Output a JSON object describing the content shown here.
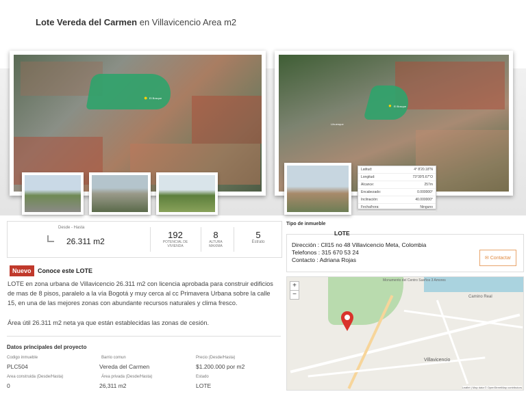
{
  "header": {
    "title_bold": "Lote Vereda del Carmen",
    "title_rest": " en Villavicencio Area m2"
  },
  "gallery": {
    "main_photo_label": "El Bosque",
    "second_photo_label": "El Bosque",
    "second_photo_label2": "Lihuenque",
    "coords_panel": [
      {
        "label": "Latitud:",
        "value": "4° 8'20.18\"N"
      },
      {
        "label": "Longitud:",
        "value": "73°39'5.67\"O"
      },
      {
        "label": "Alcance:",
        "value": "257m"
      },
      {
        "label": "Encabezado:",
        "value": "0.000000°"
      },
      {
        "label": "Inclinación:",
        "value": "40.000000°"
      },
      {
        "label": "Fecha/hora:",
        "value": "Ninguno"
      }
    ]
  },
  "stats": {
    "range_label": "Desde - Hasta",
    "area": "26.311 m2",
    "potencial_value": "192",
    "potencial_label1": "POTENCIAL DE",
    "potencial_label2": "VIVIENDA",
    "altura_value": "8",
    "altura_label1": "ALTURA",
    "altura_label2": "MAXIMA",
    "estrato_value": "5",
    "estrato_label": "Estrato"
  },
  "description": {
    "badge": "Nuevo",
    "heading": "Conoce este LOTE",
    "text": "LOTE en zona urbana de Villavicencio 26.311 m2 con licencia aprobada para construir edificios de mas de 8 pisos, paralelo a la vía Bogotá y muy cerca al cc Primavera Urbana sobre la calle 15, en una de las mejores zonas con abundante recursos naturales y clima fresco.",
    "text2": "Área útil 26.311 m2 neta ya que están establecidas las zonas de cesión."
  },
  "project": {
    "heading": "Datos principales del proyecto",
    "codigo_label": "Codigo inmueble",
    "codigo_value": "PLC504",
    "barrio_label": "Barrio comun",
    "barrio_value": "Vereda del Carmen",
    "precio_label": "Precio (Desde/Hasta)",
    "precio_value": "$1.200.000 por m2",
    "area_const_label": "Area construida (Desde/Hasta)",
    "area_const_value": "0",
    "area_priv_label": "Área privada (Desde/Hasta)",
    "area_priv_value": "26,311 m2",
    "estado_label": "Estado",
    "estado_value": "LOTE"
  },
  "contact": {
    "tipo_label": "Tipo de inmueble",
    "tipo_value": "LOTE",
    "direccion": "Dirección : Cll15 no 48 Villavicencio Meta, Colombia",
    "telefonos": "Telefonos : 315 670 53 24",
    "contacto": "Contacto : Adriana Rojas",
    "button": "Contactar"
  },
  "map": {
    "zoom_in": "+",
    "zoom_out": "−",
    "label_city": "Villavicencio",
    "label_road": "Camino Real",
    "label_top": "Monumento del Centro Sueños 3 Amores",
    "attribution": "Leaflet | Map data © OpenStreetMap contributors",
    "colors": {
      "marker": "#d9332b",
      "park": "#a9d4a0",
      "water": "#aad3df"
    }
  }
}
